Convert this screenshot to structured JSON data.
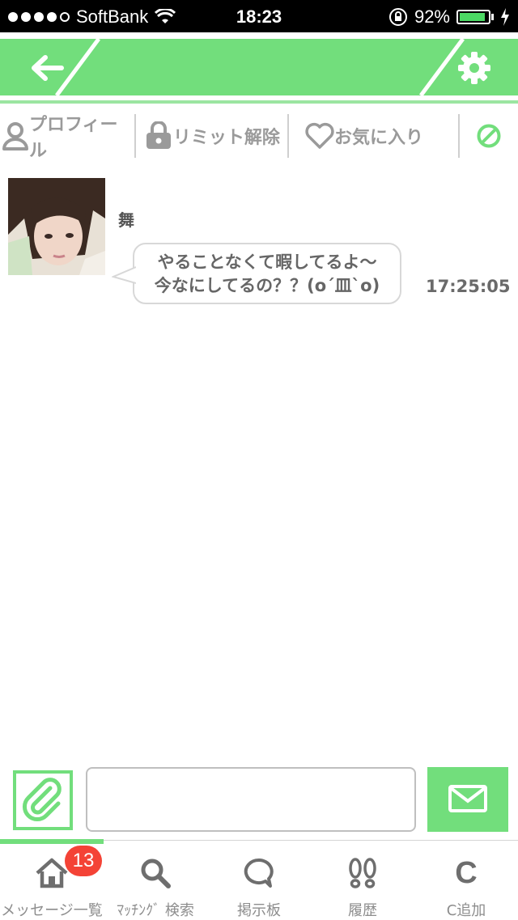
{
  "status_bar": {
    "carrier": "SoftBank",
    "time": "18:23",
    "battery_percent": "92%",
    "battery_level": 0.92,
    "signal_dots_filled": 4,
    "signal_dots_total": 5
  },
  "header": {
    "accent_color": "#72de7c",
    "back_icon": "arrow-left-icon",
    "settings_icon": "gear-icon"
  },
  "actions": {
    "profile": "プロフィール",
    "limit_unlock": "リミット解除",
    "favorite": "お気に入り",
    "block_icon": "block-icon"
  },
  "message": {
    "sender_name": "舞",
    "text_line1": "やることなくて暇してるよ〜",
    "text_line2": "今なにしてるの？？(o´皿`o)",
    "time": "17:25:05"
  },
  "composer": {
    "attach_icon": "paperclip-icon",
    "input_value": "",
    "placeholder": "",
    "send_icon": "envelope-icon"
  },
  "tabbar": {
    "tabs": [
      {
        "label": "メッセージ一覧",
        "icon": "home-icon",
        "badge": "13"
      },
      {
        "label": "ﾏｯﾁﾝｸﾞ 検索",
        "icon": "search-icon"
      },
      {
        "label": "掲示板",
        "icon": "speech-bubble-icon"
      },
      {
        "label": "履歴",
        "icon": "footprints-icon"
      },
      {
        "label": "C追加",
        "icon": "c-letter-icon",
        "letter": "C"
      }
    ],
    "active_index": 0
  }
}
